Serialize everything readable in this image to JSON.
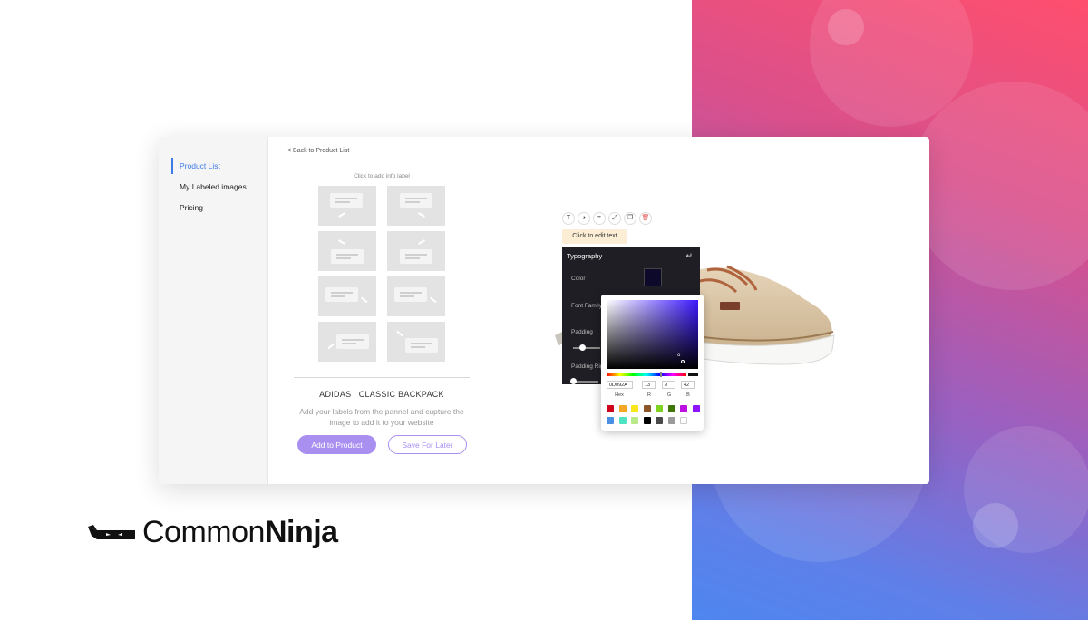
{
  "sidebar": {
    "items": [
      {
        "label": "Product List",
        "active": true
      },
      {
        "label": "My Labeled images",
        "active": false
      },
      {
        "label": "Pricing",
        "active": false
      }
    ]
  },
  "nav": {
    "back_label": "< Back to Product List"
  },
  "label_panel": {
    "hint": "Click to add info label"
  },
  "product": {
    "name": "ADIDAS | CLASSIC BACKPACK",
    "description": "Add your labels from the pannel and cupture the image to add it to your website",
    "primary_button": "Add to Product",
    "secondary_button": "Save For Later"
  },
  "editor": {
    "toolbar_icons": [
      "text-icon",
      "palette-icon",
      "crop-icon",
      "resize-icon",
      "duplicate-icon",
      "trash-icon"
    ],
    "toolbar_glyphs": [
      "T",
      "◕",
      "⌗",
      "⤢",
      "❐",
      "🗑"
    ],
    "edit_tooltip": "Click to edit text"
  },
  "typography": {
    "title": "Typography",
    "back_icon": "↵",
    "color_label": "Color",
    "font_family_label": "Font Family",
    "padding_label": "Padding",
    "padding_right_label": "Padding Righ",
    "current_color": "#0d092a"
  },
  "color_picker": {
    "hex": "0D092A",
    "r": "13",
    "g": "9",
    "b": "42",
    "cursor_value": "o",
    "labels": {
      "hex": "Hex",
      "r": "R",
      "g": "G",
      "b": "B"
    },
    "swatches": [
      "#d0021b",
      "#f5a623",
      "#f8e71c",
      "#8b572a",
      "#7ed321",
      "#417505",
      "#bd10e0",
      "#9013fe",
      "#4a90e2",
      "#50e3c2",
      "#b8e986",
      "#000000",
      "#4a4a4a",
      "#9b9b9b",
      "#ffffff"
    ]
  },
  "brand": {
    "name_light": "Common",
    "name_bold": "Ninja"
  },
  "colors": {
    "accent": "#a98ff0",
    "active_link": "#3d7be6",
    "panel_dark": "#1e1e24"
  }
}
